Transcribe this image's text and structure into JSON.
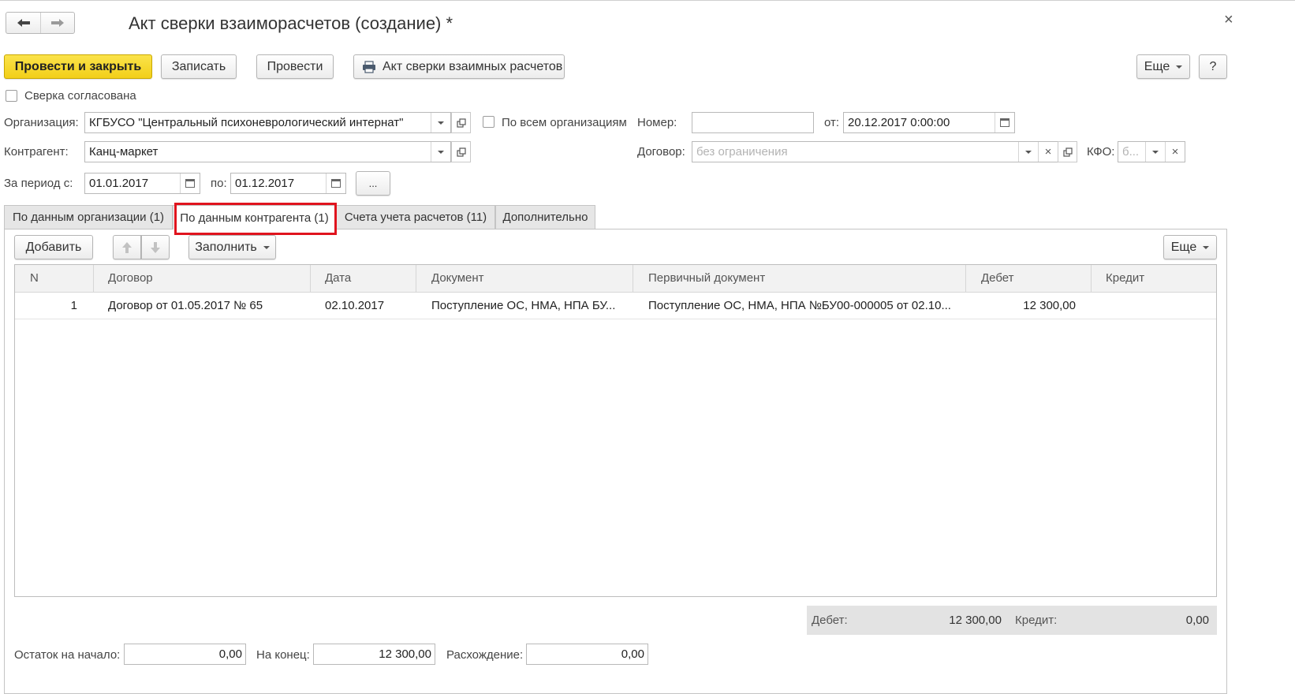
{
  "window": {
    "title": "Акт сверки взаиморасчетов (создание) *",
    "close_glyph": "×"
  },
  "toolbar": {
    "post_close": "Провести и закрыть",
    "save": "Записать",
    "post": "Провести",
    "report": "Акт сверки взаимных расчетов",
    "more": "Еще",
    "help": "?"
  },
  "header": {
    "agreed_label": "Сверка согласована",
    "org_label": "Организация:",
    "org_value": "КГБУСО \"Центральный психоневрологический интернат\"",
    "all_orgs_label": "По всем организациям",
    "number_label": "Номер:",
    "number_value": "",
    "from_label": "от:",
    "date_value": "20.12.2017  0:00:00",
    "contractor_label": "Контрагент:",
    "contractor_value": "Канц-маркет",
    "contract_label": "Договор:",
    "contract_placeholder": "без ограничения",
    "kfo_label": "КФО:",
    "kfo_placeholder": "б...",
    "period_label": "За период с:",
    "period_from": "01.01.2017",
    "period_to_label": "по:",
    "period_to": "01.12.2017",
    "period_more": "..."
  },
  "tabs": [
    {
      "label": "По данным организации (1)"
    },
    {
      "label": "По данным контрагента (1)"
    },
    {
      "label": "Счета учета расчетов (11)"
    },
    {
      "label": "Дополнительно"
    }
  ],
  "active_tab_highlight": "#e0141e",
  "table_toolbar": {
    "add": "Добавить",
    "fill": "Заполнить",
    "more": "Еще"
  },
  "table": {
    "columns": [
      "N",
      "Договор",
      "Дата",
      "Документ",
      "Первичный документ",
      "Дебет",
      "Кредит"
    ],
    "rows": [
      {
        "n": "1",
        "contract": "Договор от 01.05.2017 № 65",
        "date": "02.10.2017",
        "document": "Поступление ОС, НМА, НПА БУ...",
        "primary": "Поступление ОС, НМА, НПА №БУ00-000005 от 02.10...",
        "debit": "12 300,00",
        "credit": ""
      }
    ]
  },
  "totals": {
    "debit_label": "Дебет:",
    "debit_value": "12 300,00",
    "credit_label": "Кредит:",
    "credit_value": "0,00"
  },
  "footer": {
    "start_label": "Остаток на начало:",
    "start_value": "0,00",
    "end_label": "На конец:",
    "end_value": "12 300,00",
    "diff_label": "Расхождение:",
    "diff_value": "0,00"
  },
  "colors": {
    "primary_button": "#f2cf19",
    "tab_inactive": "#e6e6e6",
    "totals_bg": "#e3e3e3"
  }
}
